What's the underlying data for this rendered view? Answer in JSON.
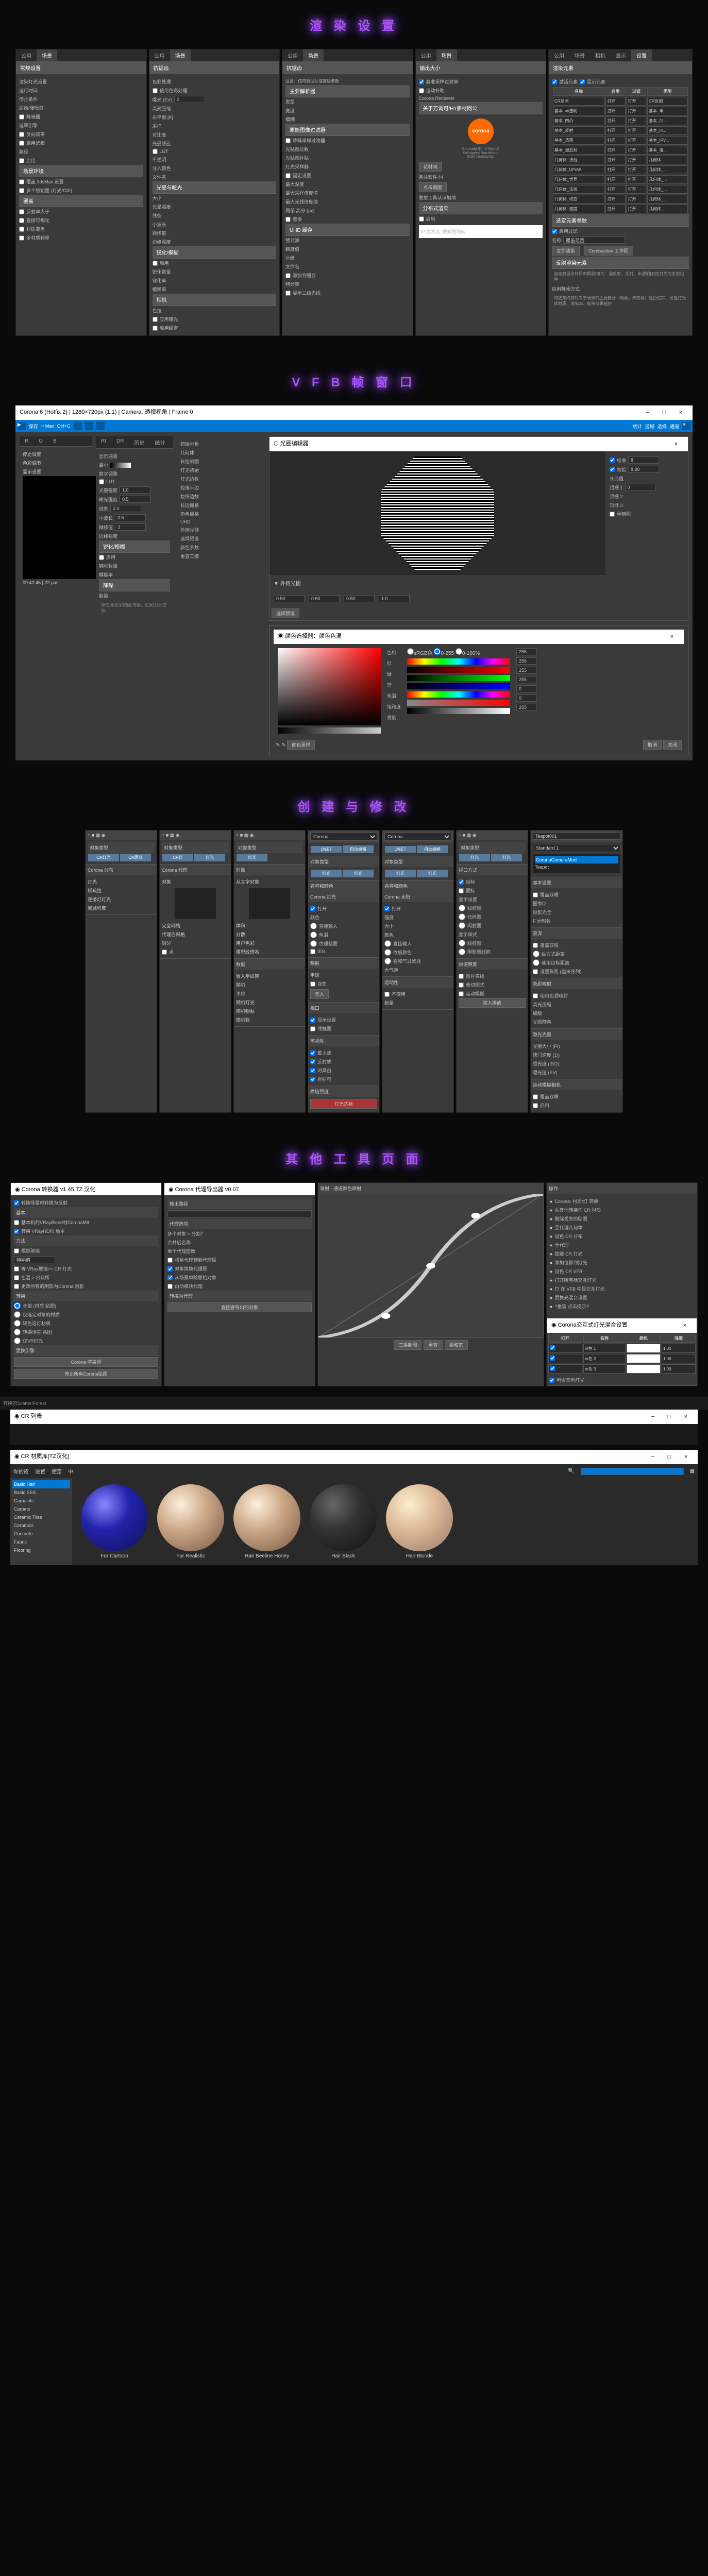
{
  "sections": {
    "render": "渲 染 设 置",
    "vfb": "V F B 帧 窗 口",
    "create": "创 建 与 修 改",
    "tools": "其 他 工 具 页 面"
  },
  "render_panels": {
    "tabs": [
      "公用",
      "场景",
      "相机",
      "显示",
      "设置"
    ],
    "p1": {
      "h": "常规设置",
      "items": [
        "渲染灯光设置",
        "运行时间",
        "停止条件",
        "原始/降噪器",
        "降噪器",
        "遮罩引擎",
        "反向隔离",
        "启用滤镜",
        "路径",
        "启用",
        "场景环境",
        "覆盖 3dsMax 设置",
        "多个初始图 (灯光/CIE)",
        "覆盖",
        "反射率大于",
        "直接可视化",
        "材质覆盖",
        "全材质转移"
      ]
    },
    "p2": {
      "h": "抗锯齿",
      "sub": "色彩处理",
      "items": [
        "使用色彩处理",
        "曝光 (EV)",
        "高光压缩",
        "白平衡 [K]",
        "采样",
        "对比度",
        "光晏感应",
        "LUT",
        "不透明",
        "注入额色",
        "文件名"
      ],
      "h2": "光晕与眩光",
      "items2": [
        "大小",
        "光晕强度",
        "线条",
        "小波长",
        "微移值",
        "边缘强度"
      ],
      "h3": "锐化/模糊",
      "items3": [
        "启用",
        "锐化数量",
        "锑化率",
        "模糊率"
      ],
      "h4": "相机",
      "items4": [
        "色拉",
        "应用曝光",
        "启用缓定"
      ]
    },
    "p3": {
      "h": "抗锯齿",
      "items": [
        "注意：仅可测试认证高级参数",
        "类型",
        "宽度",
        "模糊",
        "降噪采样过滤器",
        "光贴图总数",
        "光贴图补贴",
        "灯光采样器",
        "固定设置",
        "最大深度",
        "最大采样倍度值",
        "最大光线倍度值",
        "局部 高分 (px)",
        "置换"
      ],
      "h2": "UHD 缓存",
      "items2": [
        "预计算",
        "精度值",
        "分级",
        "文件名",
        "添加到缓存",
        "特计算",
        "显示二级光线"
      ]
    },
    "p4": {
      "h": "输出大小",
      "items": [
        "1",
        "2",
        "基准采样过滤单",
        "运动补助",
        "关于万调可/H1素材网公",
        "花材网",
        "备注软件小I",
        "点击填图",
        "发射工具认识加纳"
      ],
      "h2": "分布式渲染",
      "items2": [
        "启用",
        "IP/主机名",
        "搜索局域网"
      ]
    },
    "p5": {
      "h": "渲染元素",
      "t": "名称",
      "cols": [
        "启用",
        "过滤",
        "类型"
      ],
      "rows": [
        [
          "CR反照",
          "打开",
          "打开",
          "CR反照"
        ],
        [
          "基本_半透明",
          "打开",
          "打开",
          "基本_半..."
        ],
        [
          "基本_凹凸",
          "打开",
          "打开",
          "基本_凹..."
        ],
        [
          "基本_反射",
          "打开",
          "打开",
          "基本_III..."
        ],
        [
          "基本_透落",
          "打开",
          "打开",
          "基本_IPV..."
        ],
        [
          "基本_漫反射",
          "打开",
          "打开",
          "基本_漫..."
        ],
        [
          "几何体_法线",
          "打开",
          "打开",
          "几何体_..."
        ],
        [
          "几何体_UPoW",
          "打开",
          "打开",
          "几何体_..."
        ],
        [
          "几何体_世界",
          "打开",
          "打开",
          "几何体_..."
        ],
        [
          "几何体_法线",
          "打开",
          "打开",
          "几何体_..."
        ],
        [
          "几何体_切变",
          "打开",
          "打开",
          "几何体_..."
        ],
        [
          "几何体_速度",
          "打开",
          "打开",
          "几何体_..."
        ]
      ],
      "opts": "选定元素参数",
      "cb": "启用过滤",
      "name": "名称",
      "nameval": "覆盖范围",
      "btns": [
        "立即渲染",
        "Combustion 工作区"
      ],
      "h3": "反射渲染元素",
      "note1": "选定将显示材质ID属景[可为：漫反射、反射、半透明]对应灯光的反射组件",
      "note2": "应用降噪方式",
      "note3": "可选定终效时决于场景的主要部分（地板、天花板）是否追踪、还是灯光体材质、增加2x、能降效果越好"
    }
  },
  "vfb": {
    "title": "Corona 6 (Hotfix 2) | 1280×720px (1:1) | Camera: 透视视角 | Frame 0",
    "toolbar": [
      "保存",
      "= Max",
      "Ctrl+C",
      "历史",
      "历史",
      "历史",
      "历史",
      "统计",
      "区域",
      "选择",
      "通道"
    ],
    "tabs": [
      "R",
      "G",
      "B",
      "RI",
      "DR",
      "历史",
      "统计"
    ],
    "left": {
      "items": [
        "停止设置",
        "色彩调节",
        "显示设置",
        "时间"
      ],
      "time": "09:42:46 | 22 pas"
    },
    "mid": {
      "items": [
        "显示通道",
        "最小",
        "数字调整",
        "LUT",
        "光晏强度",
        "眩光强度",
        "线条",
        "小波长",
        "微移值",
        "边缘强度",
        "锐化/模糊",
        "启用",
        "钝化数量",
        "模糊率",
        "降噪",
        "数量"
      ],
      "vals": [
        "1.0",
        "0.5",
        "2.0",
        "0.5",
        "3"
      ],
      "note": "原使用(色彩的图\n向最，设果)对比应\n较。"
    },
    "right": {
      "h": "光圈编辑器",
      "items": [
        "初始",
        "初始分析",
        "几何体",
        "长拉帧图",
        "灯光初始",
        "灯光边数",
        "粒缘半边",
        "粒织边数",
        "长边栅格",
        "角色栅格",
        "外侧光栅",
        "选择预设",
        "颜色系数",
        "重容三模"
      ],
      "cb": [
        "标准",
        "初始",
        "长比值",
        "顶栅 1",
        "顶栅 2",
        "顶栅 3",
        "重暗图"
      ],
      "vals": [
        "8",
        "8.20",
        "0",
        "1.0",
        "0.50",
        "0.50",
        "0.50"
      ]
    },
    "color": {
      "h": "颜色选择器：颜色色温",
      "labs": [
        "色相",
        "红",
        "绿",
        "蓝",
        "色温",
        "饱和度",
        "亮度"
      ],
      "val": "255",
      "radio": [
        "sRGB色",
        "0-255",
        "0-100%"
      ],
      "btns": [
        "颜色采样",
        "取消",
        "关闭"
      ]
    }
  },
  "create": {
    "panels": [
      {
        "h": "对象类型",
        "btns": [
          "CR灯光",
          "CR面灯"
        ],
        "h2": "Corona 分布",
        "items": [
          "灯光",
          "稀疏拉",
          "连接灯灯光",
          "衰减程度"
        ]
      },
      {
        "h": "对象类型",
        "btns": [
          "CR灯",
          "灯光"
        ],
        "h2": "Corona 代理",
        "items": [
          "对象",
          "完全网格",
          "代理自网格",
          "呀分",
          "点"
        ]
      },
      {
        "h": "对象类型",
        "btns": [
          "灯光",
          "自动编格"
        ],
        "h2": "对象",
        "items": [
          "从文字对象",
          "体积",
          "分散",
          "用户色彩",
          "模型纹理名"
        ],
        "h3": "数据",
        "items3": [
          "置入学成算",
          "随机",
          "平纱",
          "随机灯光",
          "随机物贴",
          "随机数"
        ]
      },
      {
        "h": "Corona",
        "btns": [
          "1%E7",
          "自动编格"
        ],
        "h2": "对象类型",
        "btns2": [
          "灯光",
          "灯光"
        ],
        "h3": "名称和颜色",
        "h4": "Corona 灯光",
        "items": [
          "打开",
          "颜色",
          "直接输入",
          "色温",
          "纹理贴图",
          "IES"
        ],
        "h5": "映射",
        "items5": [
          "半球",
          "双面",
          "无人"
        ],
        "h6": "视口",
        "items6": [
          "显示设置",
          "线框图"
        ],
        "h7": "可视性",
        "items7": [
          "戴上故",
          "反射故",
          "对其自",
          "折射可"
        ],
        "h8": "烘培照度",
        "items8": [
          "灯光达标"
        ]
      },
      {
        "h": "Corona",
        "btns": [
          "1%E7",
          "自动编格"
        ],
        "h2": "对象类型",
        "btns2": [
          "灯光",
          "灯光"
        ],
        "h3": "名称和颜色",
        "h4": "Corona 太阳",
        "items": [
          "打开",
          "强度",
          "大小",
          "颜色",
          "直接输入",
          "纹板颜色",
          "强和气过滤器",
          "大气道"
        ],
        "h5": "运动性",
        "items5": [
          "不使用",
          "数量"
        ]
      },
      {
        "h": "对象类型",
        "btns": [
          "灯光",
          "灯光"
        ],
        "h2": "视口方式",
        "items": [
          "目标",
          "图标",
          "显示设置",
          "线框图",
          "代码图",
          "闪射图",
          "显示样式",
          "线框图",
          "阴影图线框"
        ],
        "h3": "烘培照度",
        "items3": [
          "图片实线",
          "裁切图式",
          "运动模糊"
        ],
        "btn": "添入播放"
      },
      {
        "h": "Teapot001",
        "sub": "Standard 1",
        "items": [
          "CoronaCameraMod",
          "Teapot"
        ],
        "h2": "基本设置",
        "items2": [
          "覆盖双眼",
          "捆绑Q",
          "投影光全",
          "F 计时数"
        ],
        "h3": "景深",
        "items3": [
          "覆盖双眼",
          "纵方式距离",
          "使用目标距离",
          "设置焦距 (厘米序列)"
        ],
        "h4": "色彩映射",
        "items4": [
          "使用色调映射",
          "高光压缩",
          "编级",
          "光图额色"
        ],
        "h5": "激光光图",
        "items5": [
          "光圈大小 (F/)",
          "快门速度 (1/)",
          "感光度 (ISO)",
          "曝光值 (EV)"
        ],
        "h6": "运动模糊相机",
        "items6": [
          "覆盖双眼",
          "启用"
        ]
      }
    ]
  },
  "tools": {
    "p1": {
      "h": "Corona 转换器 v1.45  TZ 汉化",
      "items": [
        "转换场景时转换为反射",
        "基本机的VRayBlend材CoronaMtl",
        "转换 VRayHDRI 版本"
      ],
      "h2": "方法",
      "items2": [
        "模拟玻璃",
        "等 VRay玻璃>> CR 灯光",
        "色温 > 出伏所",
        "更改所有的阴影为Corona 阴影"
      ],
      "h3": "转换",
      "items3": [
        "全部 (材质 贴图)",
        "仅选定对象的材质",
        "转色这灯材质",
        "转换场景 贴图",
        "仅VR灯光"
      ],
      "h4": "更换引擎",
      "items4": [
        "Corona 渲染器",
        "停止所有Corona贴图"
      ]
    },
    "p2": {
      "h": "Corona 代理导出器 v0.07",
      "h2": "输出路径",
      "h3": "代理选项",
      "items": [
        "多个对象 > 分割？",
        "合并后名称",
        "单个代理面数",
        "将至代理转到代理原",
        "对象换换代理原",
        "从场景单除原始对象",
        "白动模块代理"
      ],
      "h4": "转换为代理",
      "items4": [
        "直接要导出的对象"
      ]
    },
    "p3": {
      "h": "发射 - 通道颜色映射",
      "btns": [
        "三乘制图",
        "重容",
        "柔和宽"
      ]
    },
    "p4": {
      "h": "操作",
      "items": [
        "Corona: 材质/灯 转换",
        "从其他转换任 CR 材质",
        "删除丢失的贴图",
        "至代理几何体",
        "设色 CR 分布",
        "全代理",
        "隐蔽 CR 灯光",
        "添加位移到灯光",
        "设色 CR VFB",
        "打开所有标交互灯光",
        "打 在 VFB 中显交互灯光",
        "更换光混合设置",
        "?重容 点击提示?"
      ]
    },
    "p5": {
      "h": "Corona交互式灯光混合设置",
      "cols": [
        "打开",
        "名称",
        "颜色",
        "强度"
      ],
      "rows": [
        [
          "",
          "m色 1",
          "",
          "1.00"
        ],
        [
          "",
          "m色 2",
          "",
          "1.00"
        ],
        [
          "",
          "m色 3",
          "",
          "1.00"
        ]
      ],
      "cb": "包含其他灯光"
    }
  },
  "lister": {
    "h": "CR 列表"
  },
  "matlib": {
    "h": "CR 材质库[TZ汉化]",
    "tabs": [
      "你的皮",
      "设置",
      "使定",
      "中"
    ],
    "cats": [
      "Basic Hair",
      "Basic SSS",
      "Carpaints",
      "Carpets",
      "Ceramic Tiles",
      "Ceramics",
      "Concrete",
      "Fabric",
      "Flooring"
    ],
    "thumbs": [
      "Fur Cartoon",
      "Fur Realistic",
      "Hair Beeline Honey",
      "Hair Black",
      "Hair Blonde"
    ]
  }
}
